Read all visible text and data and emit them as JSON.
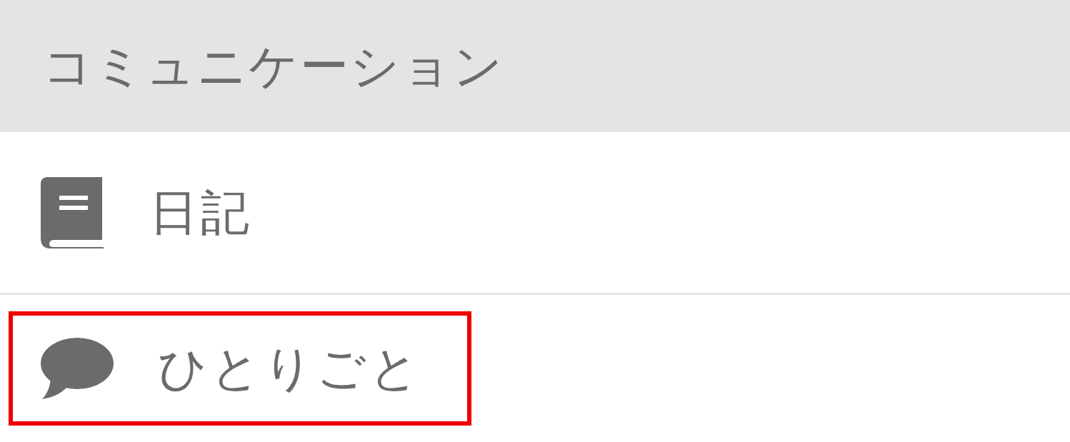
{
  "header": {
    "title": "コミュニケーション"
  },
  "items": [
    {
      "label": "日記",
      "kind": "book",
      "highlighted": false
    },
    {
      "label": "ひとりごと",
      "kind": "speech",
      "highlighted": true
    }
  ]
}
